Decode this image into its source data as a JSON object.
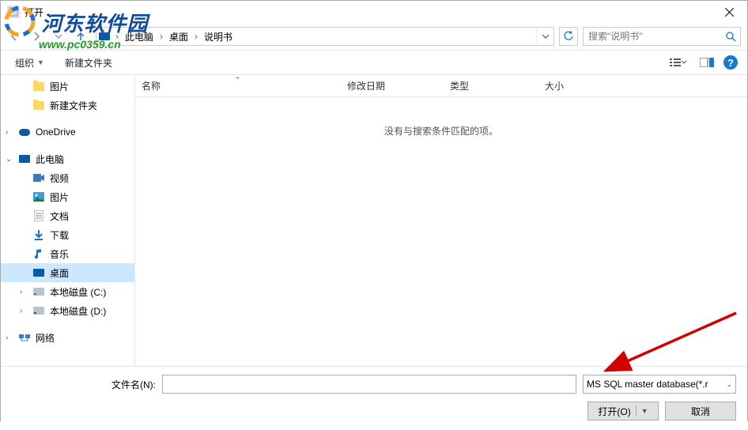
{
  "titlebar": {
    "title": "打开"
  },
  "watermark": {
    "main": "河东软件园",
    "url": "www.pc0359.cn"
  },
  "nav": {
    "breadcrumb": [
      "此电脑",
      "桌面",
      "说明书"
    ],
    "search_placeholder": "搜索\"说明书\""
  },
  "toolbar": {
    "organize": "组织",
    "newfolder": "新建文件夹"
  },
  "columns": {
    "name": "名称",
    "date": "修改日期",
    "type": "类型",
    "size": "大小"
  },
  "filelist": {
    "empty": "没有与搜索条件匹配的项。"
  },
  "sidebar": {
    "items": [
      {
        "label": "图片",
        "icon": "folder",
        "indent": true
      },
      {
        "label": "新建文件夹",
        "icon": "folder",
        "indent": true
      },
      {
        "label": "",
        "spacer": true
      },
      {
        "label": "OneDrive",
        "icon": "cloud",
        "expander": ">"
      },
      {
        "label": "",
        "spacer": true
      },
      {
        "label": "此电脑",
        "icon": "monitor",
        "expander": "v"
      },
      {
        "label": "视频",
        "icon": "video",
        "indent": true
      },
      {
        "label": "图片",
        "icon": "pictures",
        "indent": true
      },
      {
        "label": "文档",
        "icon": "docs",
        "indent": true
      },
      {
        "label": "下载",
        "icon": "download",
        "indent": true
      },
      {
        "label": "音乐",
        "icon": "music",
        "indent": true
      },
      {
        "label": "桌面",
        "icon": "desktop",
        "indent": true,
        "selected": true
      },
      {
        "label": "本地磁盘 (C:)",
        "icon": "disk-c",
        "indent": true,
        "expander": ">"
      },
      {
        "label": "本地磁盘 (D:)",
        "icon": "disk-d",
        "indent": true,
        "expander": ">"
      },
      {
        "label": "",
        "spacer": true
      },
      {
        "label": "网络",
        "icon": "network",
        "expander": ">"
      }
    ]
  },
  "footer": {
    "filename_label": "文件名(N):",
    "filename_value": "",
    "filetype": "MS SQL master database(*.r",
    "open": "打开(O)",
    "cancel": "取消"
  }
}
